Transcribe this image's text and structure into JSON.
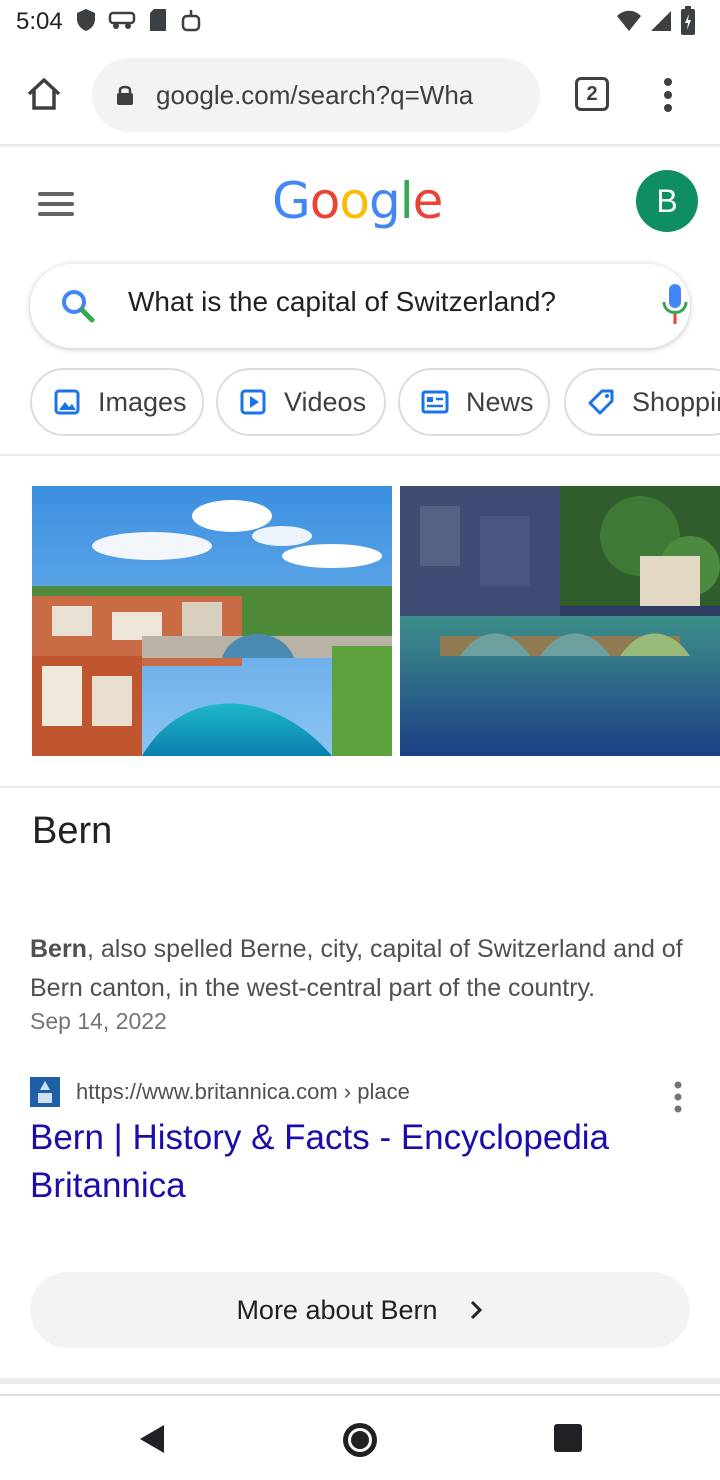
{
  "status_bar": {
    "time": "5:04"
  },
  "browser": {
    "url": "google.com/search?q=Wha",
    "tab_count": "2"
  },
  "google": {
    "logo_text": [
      "G",
      "o",
      "o",
      "g",
      "l",
      "e"
    ],
    "logo_colors": [
      "#4285F4",
      "#EA4335",
      "#FBBC05",
      "#4285F4",
      "#34A853",
      "#EA4335"
    ],
    "avatar_initial": "B",
    "avatar_color": "#0f8e61",
    "search_query": "What is the capital of Switzerland?"
  },
  "chips": [
    {
      "label": "Images",
      "icon": "image-icon"
    },
    {
      "label": "Videos",
      "icon": "play-icon"
    },
    {
      "label": "News",
      "icon": "news-icon"
    },
    {
      "label": "Shoppin",
      "icon": "tag-icon"
    }
  ],
  "answer": {
    "title": "Bern",
    "snippet_bold": "Bern",
    "snippet_rest": ", also spelled Berne, city, capital of Switzerland and of Bern canton, in the west-central part of the country.",
    "date": "Sep 14, 2022",
    "source_url": "https://www.britannica.com › place",
    "link_title": "Bern | History & Facts - Encyclopedia Britannica",
    "more_button": "More about Bern"
  },
  "colors": {
    "link": "#1a0dab",
    "accent_blue": "#4285F4"
  }
}
